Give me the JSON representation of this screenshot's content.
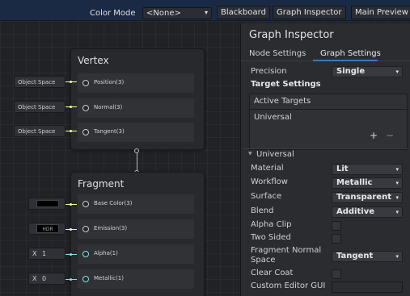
{
  "toolbar": {
    "color_mode_label": "Color Mode",
    "color_mode_value": "<None>",
    "blackboard_label": "Blackboard",
    "graph_inspector_label": "Graph Inspector",
    "main_preview_label": "Main Preview"
  },
  "vertex_node": {
    "title": "Vertex",
    "slots": [
      {
        "label": "Position(3)",
        "input": "Object Space"
      },
      {
        "label": "Normal(3)",
        "input": "Object Space"
      },
      {
        "label": "Tangent(3)",
        "input": "Object Space"
      }
    ]
  },
  "fragment_node": {
    "title": "Fragment",
    "slots": [
      {
        "label": "Base Color(3)"
      },
      {
        "label": "Emission(3)",
        "input": "HDR"
      },
      {
        "label": "Alpha(1)",
        "input_prefix": "X",
        "input_value": "1"
      },
      {
        "label": "Metallic(1)",
        "input_prefix": "X",
        "input_value": "0"
      }
    ]
  },
  "inspector": {
    "title": "Graph Inspector",
    "tabs": [
      "Node Settings",
      "Graph Settings"
    ],
    "precision_label": "Precision",
    "precision_value": "Single",
    "target_settings_label": "Target Settings",
    "active_targets_label": "Active Targets",
    "active_target_item": "Universal",
    "add_symbol": "+",
    "remove_symbol": "−",
    "universal_section": "Universal",
    "section_arrow": "▼",
    "properties": [
      {
        "label": "Material",
        "value": "Lit"
      },
      {
        "label": "Workflow",
        "value": "Metallic"
      },
      {
        "label": "Surface",
        "value": "Transparent"
      },
      {
        "label": "Blend",
        "value": "Additive"
      }
    ],
    "checkbox_properties": [
      {
        "label": "Alpha Clip"
      },
      {
        "label": "Two Sided"
      }
    ],
    "fragment_normal_label_line1": "Fragment Normal",
    "fragment_normal_label_line2": "Space",
    "fragment_normal_value": "Tangent",
    "clear_coat_label": "Clear Coat",
    "custom_editor_label": "Custom Editor GUI"
  },
  "colors": {
    "toolbar_bg": "#1b2a44",
    "wire_vector3": "#f6ff9a",
    "wire_vector1": "#84e4e7",
    "accent": "#3b78c4"
  },
  "icons": {
    "dropdown": "▾"
  }
}
